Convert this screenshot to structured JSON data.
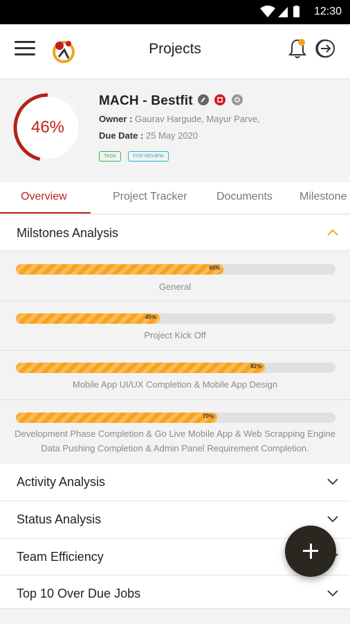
{
  "status_bar": {
    "time": "12:30"
  },
  "app_bar": {
    "title": "Projects"
  },
  "project": {
    "progress_text": "46%",
    "progress": 0.46,
    "name": "MACH - Bestfit",
    "owner_label": "Owner :",
    "owner_value": "Gaurav Hargude, Mayur Parve,",
    "due_label": "Due Date :",
    "due_value": "25 May 2020",
    "tags": [
      {
        "label": "TASK",
        "color": "#39b54a"
      },
      {
        "label": "FOR REVIEW",
        "color": "#29b6c6"
      }
    ]
  },
  "tabs": [
    "Overview",
    "Project Tracker",
    "Documents",
    "Milestone"
  ],
  "milestones_section": {
    "title": "Milstones Analysis"
  },
  "milestones": [
    {
      "value_text": "65%",
      "progress": 0.65,
      "label": "General"
    },
    {
      "value_text": "45%",
      "progress": 0.45,
      "label": "Project Kick Off"
    },
    {
      "value_text": "82%",
      "progress": 0.78,
      "label": "Mobile App UI/UX Completion & Mobile App Design"
    },
    {
      "value_text": "70%",
      "progress": 0.63,
      "label": "Development Phase Completion & Go Live Mobile App & Web Scrapping Engine Data Pushing Completion & Admin Panel Requirement Completion."
    }
  ],
  "sections": [
    {
      "title": "Activity Analysis"
    },
    {
      "title": "Status Analysis"
    },
    {
      "title": "Team Efficiency"
    },
    {
      "title": "Top 10 Over Due Jobs"
    }
  ],
  "colors": {
    "accent": "#c0211a",
    "progress": "#f7a21e",
    "fab": "#2a2720",
    "chevron_up": "#f5a623"
  },
  "icons": [
    "wifi-icon",
    "signal-icon",
    "battery-icon",
    "hamburger-menu-icon",
    "app-logo-icon",
    "bell-icon",
    "logout-icon",
    "chevron-up-icon",
    "chevron-down-icon",
    "plus-icon"
  ]
}
